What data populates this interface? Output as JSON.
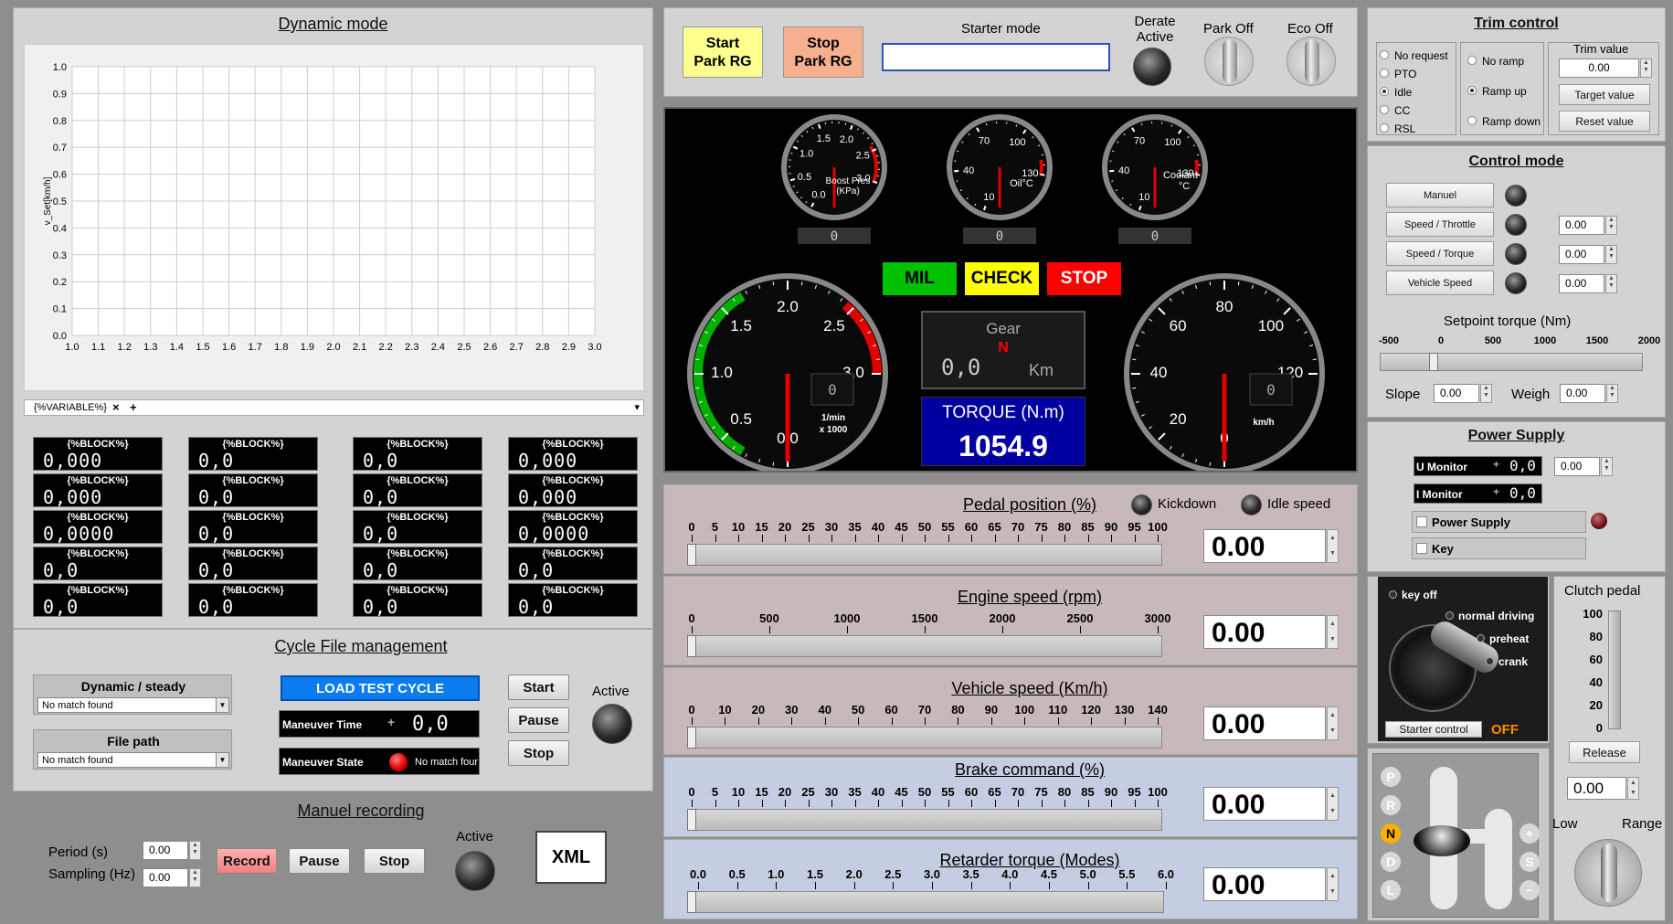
{
  "dynamic": {
    "title": "Dynamic mode",
    "ylabel": "v_Set[km/h]",
    "chart_data": {
      "type": "line",
      "title": "",
      "xlabel": "",
      "ylabel": "v_Set[km/h]",
      "xlim": [
        1.0,
        3.0
      ],
      "ylim": [
        0.0,
        1.0
      ],
      "xticks": [
        "1.0",
        "1.1",
        "1.2",
        "1.3",
        "1.4",
        "1.5",
        "1.6",
        "1.7",
        "1.8",
        "1.9",
        "2.0",
        "2.1",
        "2.2",
        "2.3",
        "2.4",
        "2.5",
        "2.6",
        "2.7",
        "2.8",
        "2.9",
        "3.0"
      ],
      "yticks": [
        "0.0",
        "0.1",
        "0.2",
        "0.3",
        "0.4",
        "0.5",
        "0.6",
        "0.7",
        "0.8",
        "0.9",
        "1.0"
      ],
      "series": [],
      "grid": true
    },
    "tab_label": "{%VARIABLE%}",
    "tab_close": "×",
    "tab_add": "+",
    "tab_menu": "▾",
    "blocks": [
      {
        "label": "{%BLOCK%}",
        "value": "0,000"
      },
      {
        "label": "{%BLOCK%}",
        "value": "0,0"
      },
      {
        "label": "{%BLOCK%}",
        "value": "0,0"
      },
      {
        "label": "{%BLOCK%}",
        "value": "0,000"
      },
      {
        "label": "{%BLOCK%}",
        "value": "0,000"
      },
      {
        "label": "{%BLOCK%}",
        "value": "0,0"
      },
      {
        "label": "{%BLOCK%}",
        "value": "0,0"
      },
      {
        "label": "{%BLOCK%}",
        "value": "0,000"
      },
      {
        "label": "{%BLOCK%}",
        "value": "0,0000"
      },
      {
        "label": "{%BLOCK%}",
        "value": "0,0"
      },
      {
        "label": "{%BLOCK%}",
        "value": "0,0"
      },
      {
        "label": "{%BLOCK%}",
        "value": "0,0000"
      },
      {
        "label": "{%BLOCK%}",
        "value": "0,0"
      },
      {
        "label": "{%BLOCK%}",
        "value": "0,0"
      },
      {
        "label": "{%BLOCK%}",
        "value": "0,0"
      },
      {
        "label": "{%BLOCK%}",
        "value": "0,0"
      },
      {
        "label": "{%BLOCK%}",
        "value": "0,0"
      },
      {
        "label": "{%BLOCK%}",
        "value": "0,0"
      },
      {
        "label": "{%BLOCK%}",
        "value": "0,0"
      },
      {
        "label": "{%BLOCK%}",
        "value": "0,0"
      }
    ]
  },
  "cycle": {
    "title": "Cycle File management",
    "dynamic_label": "Dynamic / steady",
    "dynamic_value": "No match found",
    "filepath_label": "File path",
    "filepath_value": "No match found",
    "load_button": "LOAD TEST CYCLE",
    "maneuver_time_label": "Maneuver Time",
    "maneuver_time_sign": "+",
    "maneuver_time_value": "0,0",
    "maneuver_state_label": "Maneuver State",
    "maneuver_state_value": "No match four",
    "start": "Start",
    "pause": "Pause",
    "stop": "Stop",
    "active_label": "Active"
  },
  "recording": {
    "title": "Manuel recording",
    "period_label": "Period (s)",
    "period_value": "0.00",
    "sampling_label": "Sampling (Hz)",
    "sampling_value": "0.00",
    "record": "Record",
    "pause": "Pause",
    "stop": "Stop",
    "active_label": "Active",
    "xml": "XML"
  },
  "top": {
    "start_park_line1": "Start",
    "start_park_line2": "Park RG",
    "stop_park_line1": "Stop",
    "stop_park_line2": "Park RG",
    "starter_mode_label": "Starter mode",
    "starter_mode_value": "",
    "derate_line1": "Derate",
    "derate_line2": "Active",
    "park_off": "Park Off",
    "eco_off": "Eco Off"
  },
  "dash": {
    "boost": {
      "ticks": [
        "0.0",
        "0.5",
        "1.0",
        "1.5",
        "2.0",
        "2.5",
        "3.0"
      ],
      "label1": "Boost Pres",
      "label2": "(KPa)",
      "readout": "0"
    },
    "oil": {
      "ticks": [
        "10",
        "40",
        "70",
        "100",
        "130"
      ],
      "label1": "Oil°C",
      "readout": "0"
    },
    "coolant": {
      "ticks": [
        "10",
        "40",
        "70",
        "100",
        "130"
      ],
      "label1": "Coolant",
      "label2": "°C",
      "readout": "0"
    },
    "mil": "MIL",
    "check": "CHECK",
    "stop": "STOP",
    "mil_color": "#00c000",
    "check_color": "#ffff00",
    "stop_color": "#ff0000",
    "gear_label": "Gear",
    "gear_value": "N",
    "gear_km_value": "0,0",
    "gear_km_unit": "Km",
    "torque_label": "TORQUE (N.m)",
    "torque_value": "1054.9",
    "rpm": {
      "ticks": [
        "0.0",
        "0.5",
        "1.0",
        "1.5",
        "2.0",
        "2.5",
        "3.0"
      ],
      "unit1": "1/min",
      "unit2": "x 1000",
      "readout": "0"
    },
    "speed": {
      "ticks": [
        "0",
        "20",
        "40",
        "60",
        "80",
        "100",
        "120"
      ],
      "unit": "km/h",
      "readout": "0"
    }
  },
  "sliders": [
    {
      "title": "Pedal position (%)",
      "ticks": [
        "0",
        "5",
        "10",
        "15",
        "20",
        "25",
        "30",
        "35",
        "40",
        "45",
        "50",
        "55",
        "60",
        "65",
        "70",
        "75",
        "80",
        "85",
        "90",
        "95",
        "100"
      ],
      "value": "0.00",
      "bg": "#c7b9b9",
      "kickdown": "Kickdown",
      "idle": "Idle speed"
    },
    {
      "title": "Engine speed (rpm)",
      "ticks": [
        "0",
        "500",
        "1000",
        "1500",
        "2000",
        "2500",
        "3000"
      ],
      "value": "0.00",
      "bg": "#c7b9b9"
    },
    {
      "title": "Vehicle speed (Km/h)",
      "ticks": [
        "0",
        "10",
        "20",
        "30",
        "40",
        "50",
        "60",
        "70",
        "80",
        "90",
        "100",
        "110",
        "120",
        "130",
        "140"
      ],
      "value": "0.00",
      "bg": "#c7b9b9"
    },
    {
      "title": "Brake command (%)",
      "ticks": [
        "0",
        "5",
        "10",
        "15",
        "20",
        "25",
        "30",
        "35",
        "40",
        "45",
        "50",
        "55",
        "60",
        "65",
        "70",
        "75",
        "80",
        "85",
        "90",
        "95",
        "100"
      ],
      "value": "0.00",
      "bg": "#c5cde3"
    },
    {
      "title": "Retarder torque (Modes)",
      "ticks": [
        "0.0",
        "0.5",
        "1.0",
        "1.5",
        "2.0",
        "2.5",
        "3.0",
        "3.5",
        "4.0",
        "4.5",
        "5.0",
        "5.5",
        "6.0"
      ],
      "value": "0.00",
      "bg": "#c5cde3"
    }
  ],
  "trim": {
    "title": "Trim control",
    "options": [
      "No request",
      "PTO",
      "Idle",
      "CC",
      "RSL"
    ],
    "ramp_options": [
      "No ramp",
      "Ramp up",
      "Ramp down"
    ],
    "trim_value_label": "Trim value",
    "trim_value": "0.00",
    "target_value": "Target value",
    "reset_value": "Reset value"
  },
  "control": {
    "title": "Control mode",
    "buttons": [
      "Manuel",
      "Speed / Throttle",
      "Speed / Torque",
      "Vehicle Speed"
    ],
    "values": [
      "0.00",
      "0.00",
      "0.00"
    ],
    "setpoint_label": "Setpoint torque (Nm)",
    "setpoint_ticks": [
      "-500",
      "0",
      "500",
      "1000",
      "1500",
      "2000"
    ],
    "slope_label": "Slope",
    "slope_value": "0.00",
    "weigh_label": "Weigh",
    "weigh_value": "0.00"
  },
  "power": {
    "title": "Power Supply",
    "u_label": "U Monitor",
    "u_sign": "+",
    "u_value": "0,0",
    "u_input": "0.00",
    "i_label": "I Monitor",
    "i_sign": "+",
    "i_value": "0,0",
    "power_supply": "Power Supply",
    "key": "Key"
  },
  "ignition": {
    "key_off": "key off",
    "normal_driving": "normal driving",
    "preheat": "preheat",
    "crank": "crank",
    "starter_control": "Starter control",
    "state": "OFF"
  },
  "clutch": {
    "title": "Clutch pedal",
    "ticks": [
      "100",
      "80",
      "60",
      "40",
      "20",
      "0"
    ],
    "release": "Release",
    "value": "0.00",
    "low": "Low",
    "range": "Range"
  },
  "gearbox": {
    "positions": [
      "P",
      "R",
      "N",
      "D",
      "L"
    ],
    "active": "N",
    "side": [
      "+",
      "S",
      "−"
    ]
  }
}
